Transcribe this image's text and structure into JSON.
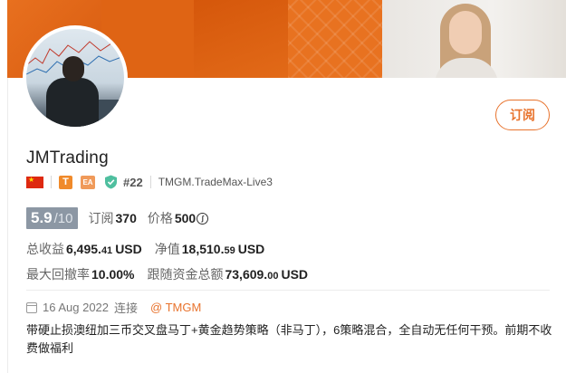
{
  "colors": {
    "accent": "#e8732d",
    "banner": "#e5671a",
    "score_bg": "#8c97a4"
  },
  "profile": {
    "name": "JMTrading",
    "subscribe_label": "订阅",
    "rank": "#22",
    "server": "TMGM.TradeMax-Live3",
    "badge_t": "T",
    "badge_ea": "EA"
  },
  "score": {
    "value": "5.9",
    "max": "/10"
  },
  "stats": {
    "subscriptions_label": "订阅",
    "subscriptions_value": "370",
    "price_label": "价格",
    "price_value": "500",
    "total_profit_label": "总收益",
    "total_profit_int": "6,495.",
    "total_profit_dec": "41",
    "total_profit_cur": "USD",
    "net_value_label": "净值",
    "net_value_int": "18,510.",
    "net_value_dec": "59",
    "net_value_cur": "USD",
    "max_drawdown_label": "最大回撤率",
    "max_drawdown_value": "10.00%",
    "follow_total_label": "跟随资金总额",
    "follow_total_int": "73,609.",
    "follow_total_dec": "00",
    "follow_total_cur": "USD"
  },
  "meta": {
    "date": "16 Aug 2022",
    "connect": "连接",
    "broker": "@ TMGM"
  },
  "description": "带硬止损澳纽加三币交叉盘马丁+黄金趋势策略（非马丁），6策略混合，全自动无任何干预。前期不收费做福利"
}
